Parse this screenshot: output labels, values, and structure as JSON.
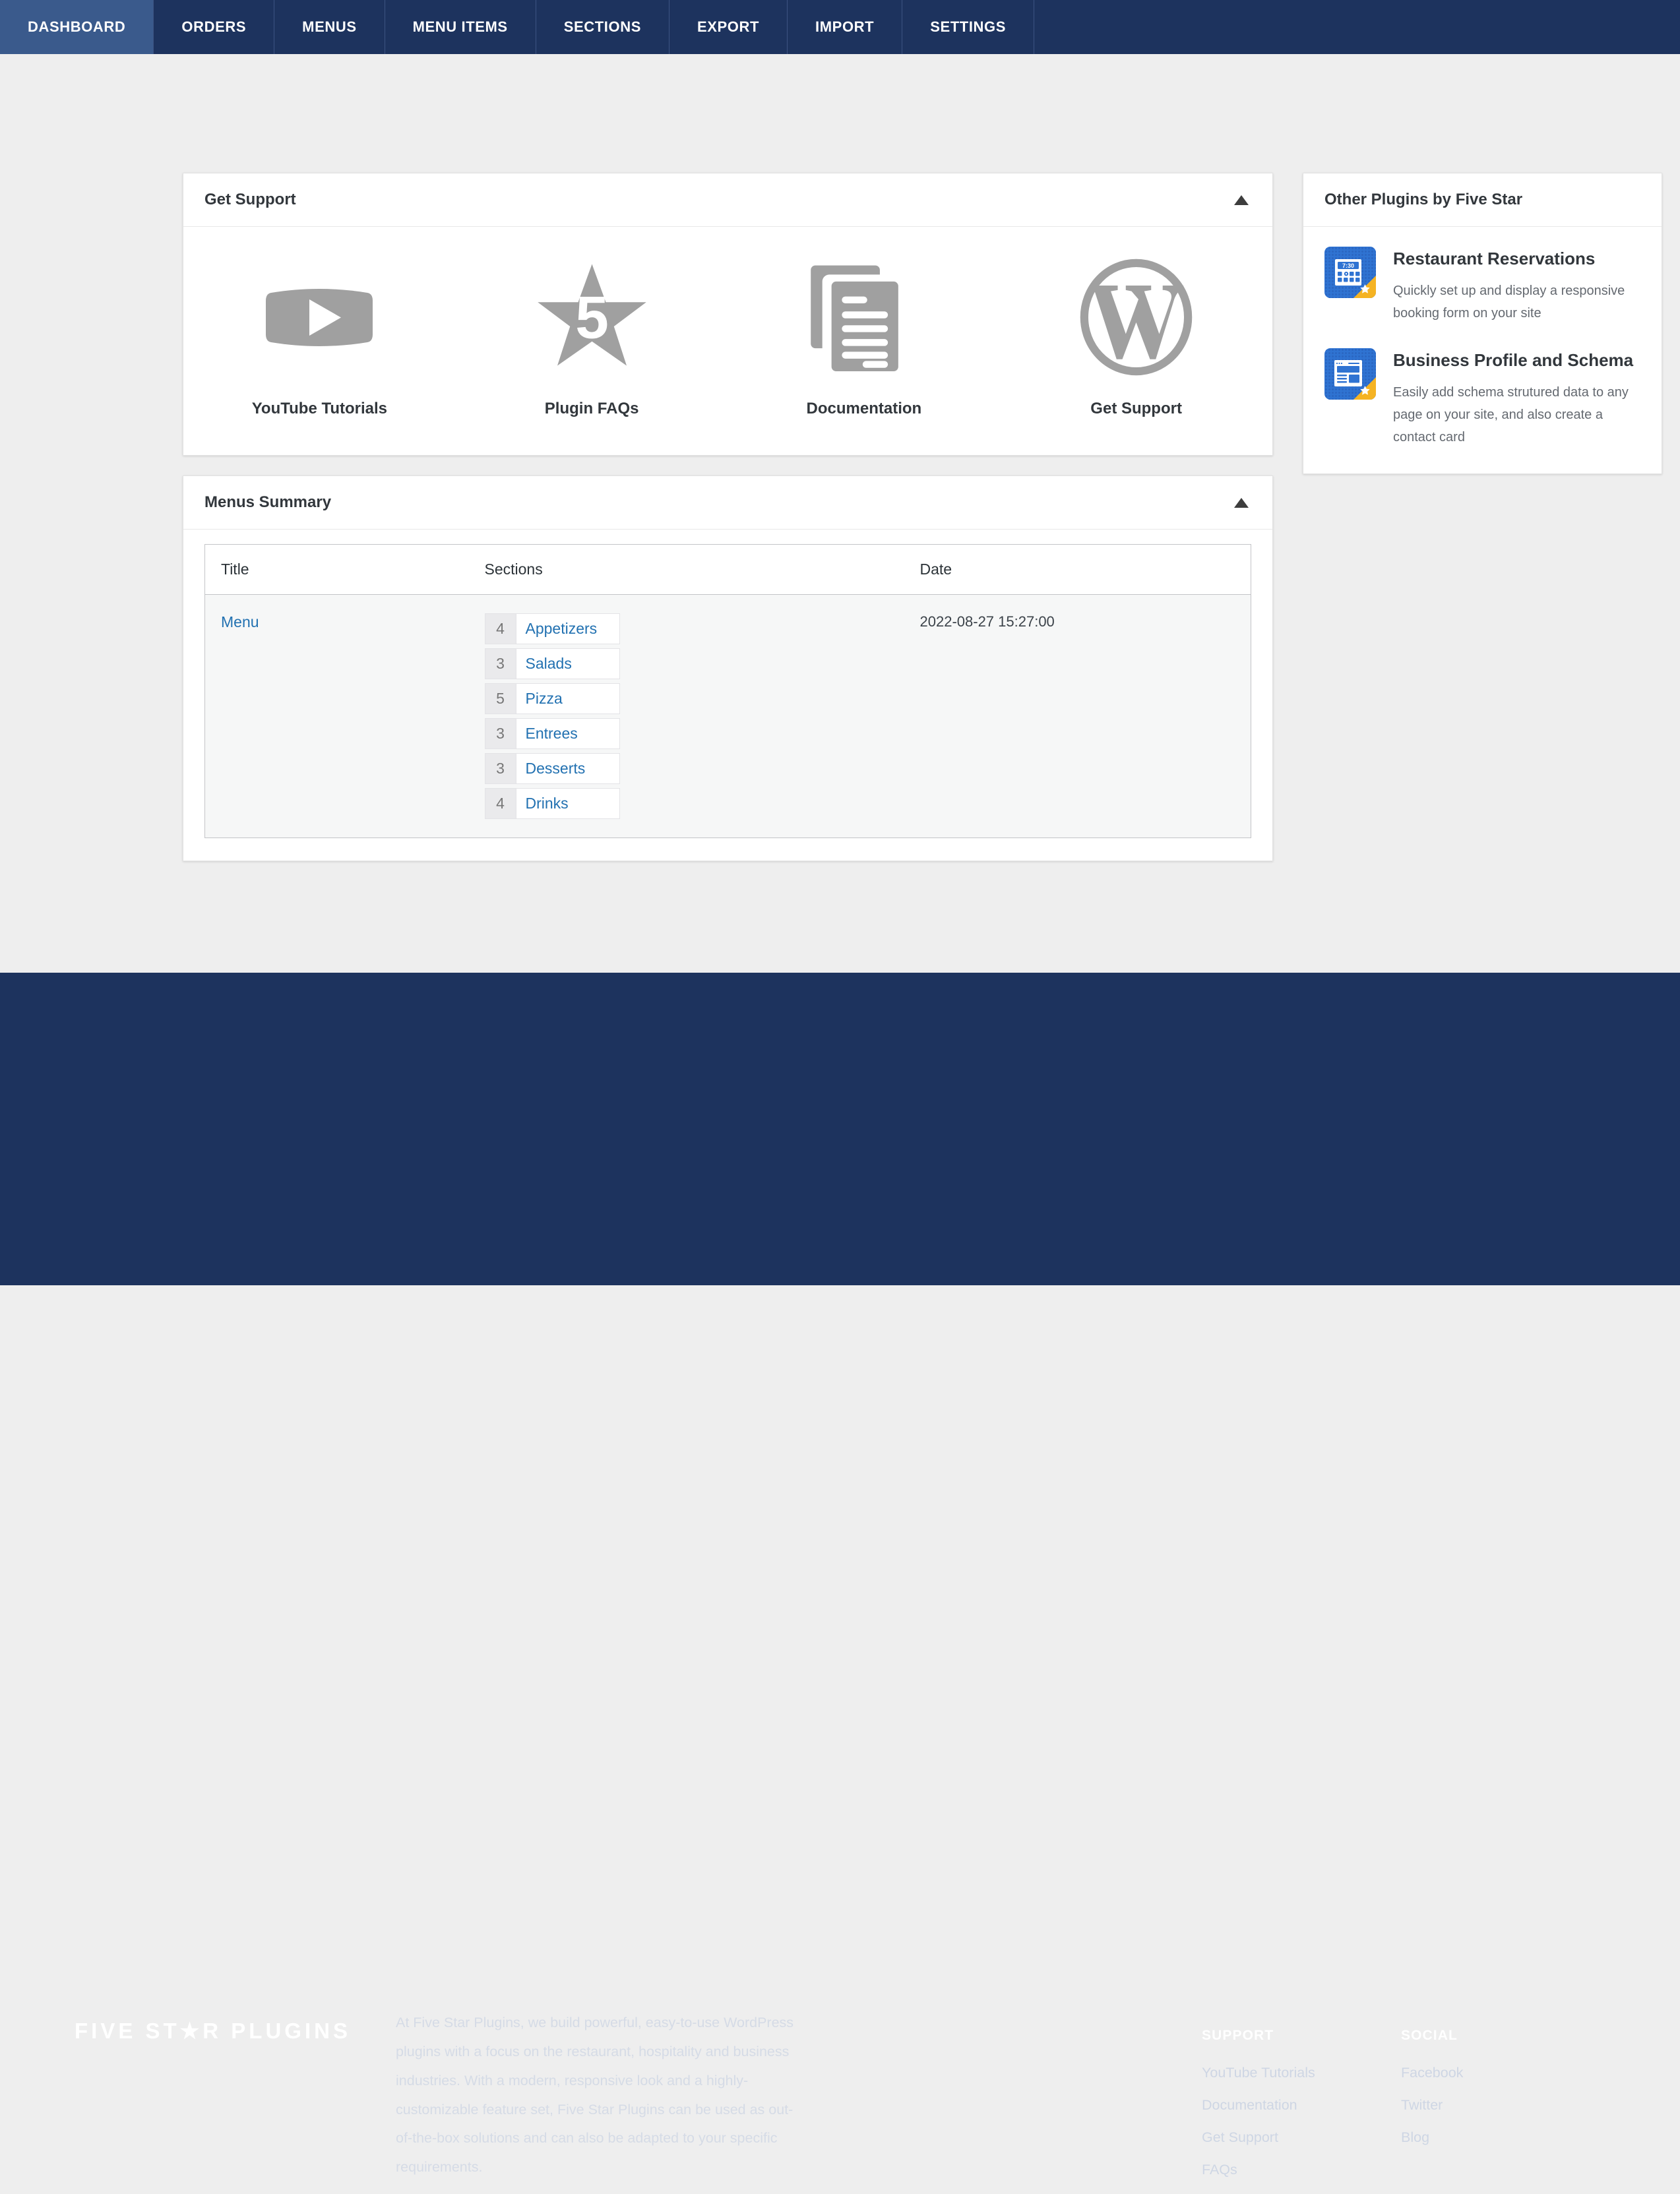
{
  "nav": {
    "tabs": [
      {
        "label": "DASHBOARD",
        "active": true
      },
      {
        "label": "ORDERS",
        "active": false
      },
      {
        "label": "MENUS",
        "active": false
      },
      {
        "label": "MENU ITEMS",
        "active": false
      },
      {
        "label": "SECTIONS",
        "active": false
      },
      {
        "label": "EXPORT",
        "active": false
      },
      {
        "label": "IMPORT",
        "active": false
      },
      {
        "label": "SETTINGS",
        "active": false
      }
    ],
    "active_color": "#3a5a8c",
    "bar_color": "#1d335e"
  },
  "support_panel": {
    "title": "Get Support",
    "toggle_icon": "triangle-up-icon",
    "items": [
      {
        "label": "YouTube Tutorials",
        "icon": "youtube-play-icon"
      },
      {
        "label": "Plugin FAQs",
        "icon": "five-star-icon"
      },
      {
        "label": "Documentation",
        "icon": "documents-icon"
      },
      {
        "label": "Get Support",
        "icon": "wordpress-icon"
      }
    ]
  },
  "menus_summary": {
    "title": "Menus Summary",
    "toggle_icon": "triangle-up-icon",
    "columns": [
      "Title",
      "Sections",
      "Date"
    ],
    "rows": [
      {
        "title": "Menu",
        "date": "2022-08-27 15:27:00",
        "sections": [
          {
            "count": "4",
            "name": "Appetizers"
          },
          {
            "count": "3",
            "name": "Salads"
          },
          {
            "count": "5",
            "name": "Pizza"
          },
          {
            "count": "3",
            "name": "Entrees"
          },
          {
            "count": "3",
            "name": "Desserts"
          },
          {
            "count": "4",
            "name": "Drinks"
          }
        ]
      }
    ]
  },
  "other_plugins": {
    "title": "Other Plugins by Five Star",
    "items": [
      {
        "name": "Restaurant Reservations",
        "desc": "Quickly set up and display a responsive booking form on your site",
        "icon": "reservation-clock-icon",
        "time_label": "7:30"
      },
      {
        "name": "Business Profile and Schema",
        "desc": "Easily add schema strutured data to any page on your site, and also create a contact card",
        "icon": "business-profile-icon"
      }
    ],
    "icon_colors": {
      "tile": "#2f73d2",
      "badge": "#f5b323"
    }
  },
  "footer": {
    "logo": {
      "before": "FIVE ST",
      "star": "★",
      "after": "R PLUGINS"
    },
    "about": "At Five Star Plugins, we build powerful, easy-to-use WordPress plugins with a focus on the restaurant, hospitality and business industries. With a modern, responsive look and a highly-customizable feature set, Five Star Plugins can be used as out-of-the-box solutions and can also be adapted to your specific requirements.",
    "columns": [
      {
        "head": "SUPPORT",
        "links": [
          "YouTube Tutorials",
          "Documentation",
          "Get Support",
          "FAQs"
        ]
      },
      {
        "head": "SOCIAL",
        "links": [
          "Facebook",
          "Twitter",
          "Blog"
        ]
      }
    ],
    "background": "#1d335e"
  },
  "colors": {
    "link": "#2271b1",
    "page_bg": "#eeeeee",
    "panel_bg": "#ffffff",
    "icon_gray": "#a0a0a0"
  }
}
